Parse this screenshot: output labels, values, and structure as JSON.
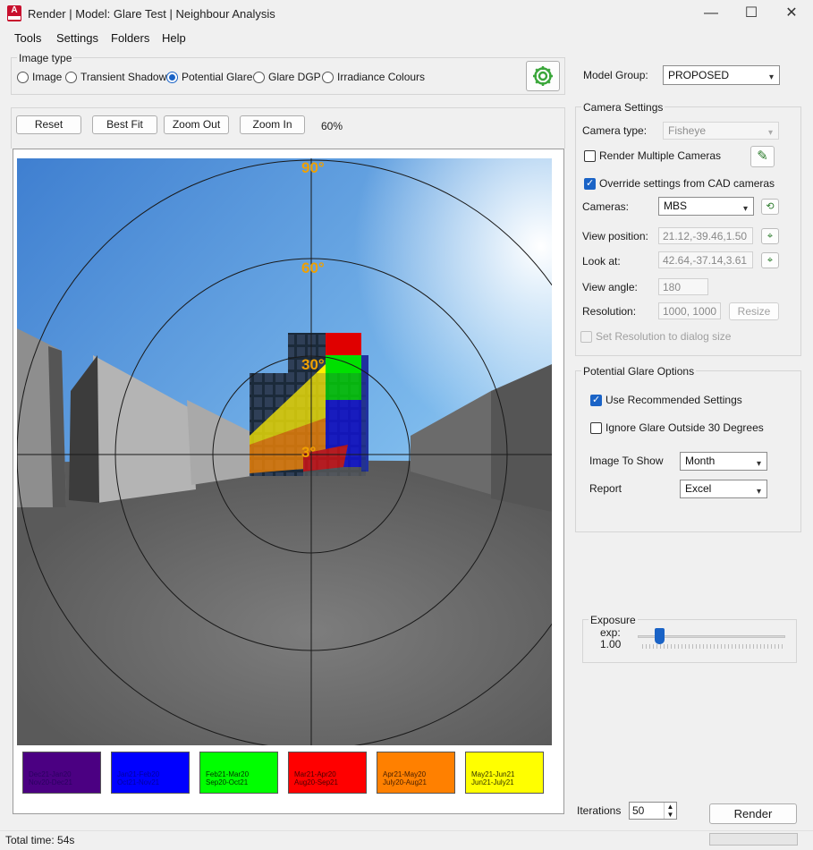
{
  "window": {
    "title": "Render | Model: Glare Test | Neighbour Analysis",
    "app_icon_letter": "A",
    "minimize_glyph": "—",
    "maximize_glyph": "☐",
    "close_glyph": "✕"
  },
  "menu": [
    "Tools",
    "Settings",
    "Folders",
    "Help"
  ],
  "image_type": {
    "title": "Image type",
    "options": [
      "Image",
      "Transient Shadow",
      "Potential Glare",
      "Glare DGP",
      "Irradiance Colours"
    ],
    "selected": "Potential Glare",
    "settings_icon": "gear-icon"
  },
  "toolbar": {
    "reset": "Reset",
    "best_fit": "Best Fit",
    "zoom_out": "Zoom Out",
    "zoom_in": "Zoom In",
    "zoom_level": "60%"
  },
  "fisheye": {
    "ring_labels": [
      "90°",
      "60°",
      "30°",
      "3°"
    ]
  },
  "legend": [
    {
      "line1": "Dec21-Jan20",
      "line2": "Nov20-Dec21",
      "color": "#4b0082",
      "text_color": "#2a0060"
    },
    {
      "line1": "Jan21-Feb20",
      "line2": "Oct21-Nov21",
      "color": "#0000ff",
      "text_color": "#0000a0"
    },
    {
      "line1": "Feb21-Mar20",
      "line2": "Sep20-Oct21",
      "color": "#00ff00",
      "text_color": "#003300"
    },
    {
      "line1": "Mar21-Apr20",
      "line2": "Aug20-Sep21",
      "color": "#ff0000",
      "text_color": "#4a0000"
    },
    {
      "line1": "Apr21-May20",
      "line2": "July20-Aug21",
      "color": "#ff8000",
      "text_color": "#4a2000"
    },
    {
      "line1": "May21-Jun21",
      "line2": "Jun21-July21",
      "color": "#ffff00",
      "text_color": "#333300"
    }
  ],
  "model_group": {
    "label": "Model Group:",
    "value": "PROPOSED"
  },
  "camera_settings": {
    "title": "Camera Settings",
    "camera_type_label": "Camera type:",
    "camera_type_value": "Fisheye",
    "render_multiple_label": "Render Multiple Cameras",
    "override_label": "Override settings from CAD cameras",
    "cameras_label": "Cameras:",
    "cameras_value": "MBS",
    "view_position_label": "View position:",
    "view_position_value": "21.12,-39.46,1.50",
    "look_at_label": "Look at:",
    "look_at_value": "42.64,-37.14,3.61",
    "view_angle_label": "View angle:",
    "view_angle_value": "180",
    "resolution_label": "Resolution:",
    "resolution_value": "1000, 1000",
    "resize_label": "Resize",
    "set_resolution_label": "Set Resolution to dialog size"
  },
  "glare_options": {
    "title": "Potential Glare Options",
    "use_recommended_label": "Use Recommended Settings",
    "ignore_outside_label": "Ignore Glare Outside 30 Degrees",
    "image_to_show_label": "Image To Show",
    "image_to_show_value": "Month",
    "report_label": "Report",
    "report_value": "Excel"
  },
  "exposure": {
    "title": "Exposure",
    "exp_label": "exp:",
    "exp_value": "1.00",
    "slider_fraction": 0.1
  },
  "iterations": {
    "label": "Iterations",
    "value": "50"
  },
  "render_button": "Render",
  "status": {
    "total_time": "Total time: 54s"
  }
}
